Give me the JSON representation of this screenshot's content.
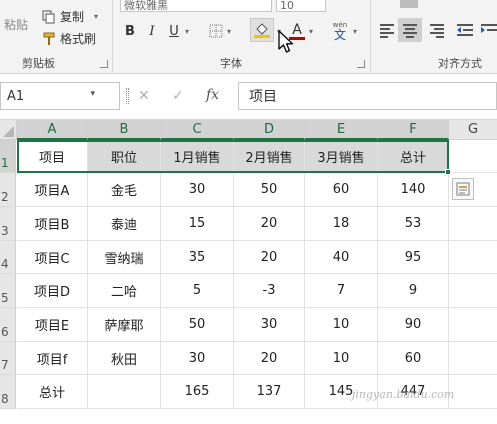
{
  "ribbon": {
    "clipboard": {
      "paste_label": "粘贴",
      "copy_label": "复制",
      "format_painter_label": "格式刷",
      "group_label": "剪贴板"
    },
    "font": {
      "font_name": "微软雅黑",
      "font_size": "10",
      "bold": "B",
      "italic": "I",
      "underline": "U",
      "font_color_glyph": "A",
      "phonetic_glyph": "文",
      "phonetic_top": "wén",
      "group_label": "字体",
      "fill_color": "#f2c100",
      "font_color": "#c00000"
    },
    "alignment": {
      "group_label": "对齐方式"
    }
  },
  "formula_bar": {
    "name_box": "A1",
    "cancel": "✕",
    "enter": "✓",
    "fx": "fx",
    "value": "项目"
  },
  "grid": {
    "columns": [
      "A",
      "B",
      "C",
      "D",
      "E",
      "F",
      "G"
    ],
    "rows": [
      "1",
      "2",
      "3",
      "4",
      "5",
      "6",
      "7",
      "8"
    ],
    "cells": [
      [
        "项目",
        "职位",
        "1月销售",
        "2月销售",
        "3月销售",
        "总计"
      ],
      [
        "项目A",
        "金毛",
        "30",
        "50",
        "60",
        "140"
      ],
      [
        "项目B",
        "泰迪",
        "15",
        "20",
        "18",
        "53"
      ],
      [
        "项目C",
        "雪纳瑞",
        "35",
        "20",
        "40",
        "95"
      ],
      [
        "项目D",
        "二哈",
        "5",
        "-3",
        "7",
        "9"
      ],
      [
        "项目E",
        "萨摩耶",
        "50",
        "30",
        "10",
        "90"
      ],
      [
        "项目f",
        "秋田",
        "30",
        "20",
        "10",
        "60"
      ],
      [
        "总计",
        "",
        "165",
        "137",
        "145",
        "447"
      ]
    ],
    "accent_color": "#217346",
    "header_fill": "#d9d9d9"
  },
  "watermark": "jingyan.baidu.com"
}
